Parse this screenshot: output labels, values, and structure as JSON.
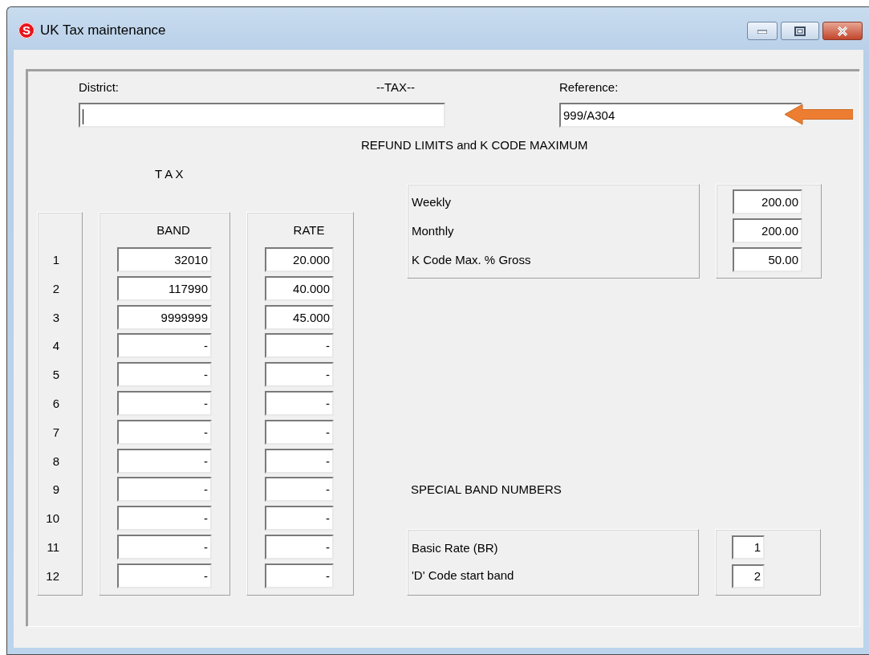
{
  "window": {
    "app_icon": "S",
    "title": "UK Tax maintenance"
  },
  "header": {
    "district_label": "District:",
    "district_focused": true,
    "title": "--TAX--",
    "reference_label": "Reference:",
    "reference_value": "999/A304"
  },
  "refund": {
    "title": "REFUND LIMITS and K CODE MAXIMUM",
    "items": [
      {
        "label": "Weekly",
        "value": "200.00"
      },
      {
        "label": "Monthly",
        "value": "200.00"
      },
      {
        "label": "K Code Max. % Gross",
        "value": "50.00"
      }
    ]
  },
  "tax": {
    "title": "T A X",
    "columns": [
      "BAND",
      "RATE"
    ],
    "rows": [
      {
        "number": "1",
        "band": "32010",
        "rate": "20.000"
      },
      {
        "number": "2",
        "band": "117990",
        "rate": "40.000"
      },
      {
        "number": "3",
        "band": "9999999",
        "rate": "45.000"
      },
      {
        "number": "4",
        "band": "-",
        "rate": "-"
      },
      {
        "number": "5",
        "band": "-",
        "rate": "-"
      },
      {
        "number": "6",
        "band": "-",
        "rate": "-"
      },
      {
        "number": "7",
        "band": "-",
        "rate": "-"
      },
      {
        "number": "8",
        "band": "-",
        "rate": "-"
      },
      {
        "number": "9",
        "band": "-",
        "rate": "-"
      },
      {
        "number": "10",
        "band": "-",
        "rate": "-"
      },
      {
        "number": "11",
        "band": "-",
        "rate": "-"
      },
      {
        "number": "12",
        "band": "-",
        "rate": "-"
      }
    ]
  },
  "special": {
    "title": "SPECIAL BAND NUMBERS",
    "items": [
      {
        "label": "Basic Rate (BR)",
        "value": "1"
      },
      {
        "label": "'D' Code start band",
        "value": "2"
      }
    ]
  }
}
